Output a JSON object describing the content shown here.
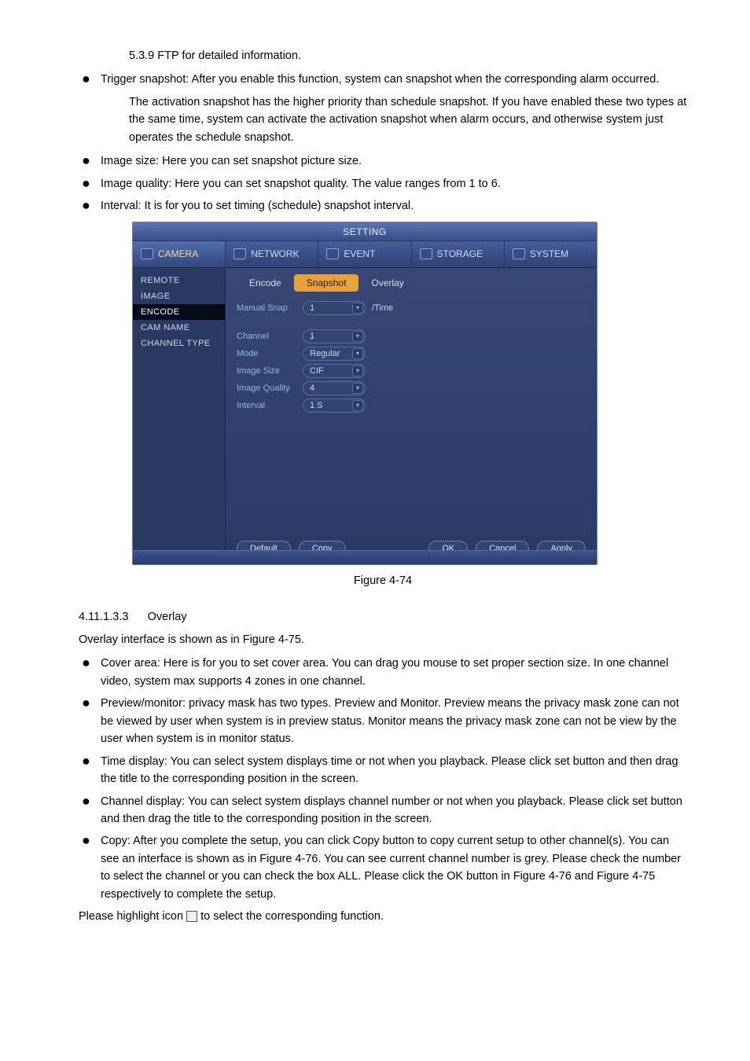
{
  "intro": {
    "line1": "5.3.9 FTP for detailed information.",
    "b1": "Trigger snapshot: After you enable this function, system can snapshot when the corresponding alarm occurred.",
    "after_b1": "The activation snapshot has the higher priority than schedule snapshot. If you have enabled these two types at the same time, system can activate the activation snapshot when alarm occurs, and otherwise system just operates the schedule snapshot.",
    "b2": "Image size: Here you can set snapshot picture size.",
    "b3": "Image quality: Here you can set snapshot quality. The value ranges from 1 to 6.",
    "b4": "Interval: It is for you to set timing (schedule) snapshot interval."
  },
  "figure": {
    "caption": "Figure 4-74",
    "title": "SETTING",
    "navtabs": [
      {
        "label": "CAMERA",
        "active": true
      },
      {
        "label": "NETWORK",
        "active": false
      },
      {
        "label": "EVENT",
        "active": false
      },
      {
        "label": "STORAGE",
        "active": false
      },
      {
        "label": "SYSTEM",
        "active": false
      }
    ],
    "sidebar": [
      {
        "label": "REMOTE",
        "active": false
      },
      {
        "label": "IMAGE",
        "active": false
      },
      {
        "label": "ENCODE",
        "active": true
      },
      {
        "label": "CAM NAME",
        "active": false
      },
      {
        "label": "CHANNEL TYPE",
        "active": false
      }
    ],
    "subtabs": [
      {
        "label": "Encode",
        "active": false
      },
      {
        "label": "Snapshot",
        "active": true
      },
      {
        "label": "Overlay",
        "active": false
      }
    ],
    "manual_snap": {
      "label": "Manual Snap",
      "value": "1",
      "suffix": "/Time"
    },
    "rows": {
      "channel": {
        "label": "Channel",
        "value": "1"
      },
      "mode": {
        "label": "Mode",
        "value": "Regular"
      },
      "image_size": {
        "label": "Image Size",
        "value": "CIF"
      },
      "image_quality": {
        "label": "Image Quality",
        "value": "4"
      },
      "interval": {
        "label": "Interval",
        "value": "1 S"
      }
    },
    "buttons": {
      "default": "Default",
      "copy": "Copy",
      "ok": "OK",
      "cancel": "Cancel",
      "apply": "Apply"
    }
  },
  "section": {
    "heading_num": "4.11.1.3.3",
    "heading_title": "Overlay",
    "intro": "Overlay interface is shown as in Figure 4-75.",
    "b1": "Cover area: Here is for you to set cover area. You can drag you mouse to set proper section size. In one channel video, system max supports 4 zones in one channel.",
    "b2": "Preview/monitor: privacy mask has two types. Preview and Monitor. Preview means the privacy mask zone can not be viewed by user when system is in preview status. Monitor means the privacy mask zone can not be view by the user when system is in monitor status.",
    "b3": "Time display: You can select system displays time or not when you playback. Please click set button and then drag the title to the corresponding position in the screen.",
    "b4": "Channel display: You can select system displays channel number or not when you playback. Please click set button and then drag the title to the corresponding position in the screen.",
    "b5": "Copy: After you complete the setup, you can click Copy button to copy current setup to other channel(s). You can see an interface is shown as in Figure 4-76. You can see current channel number is grey. Please check the number to select the channel or you can check the box ALL. Please click the OK button in Figure 4-76 and Figure 4-75 respectively to complete the setup.",
    "hl": "Please highlight icon ",
    "hl2": " to select the corresponding function."
  }
}
